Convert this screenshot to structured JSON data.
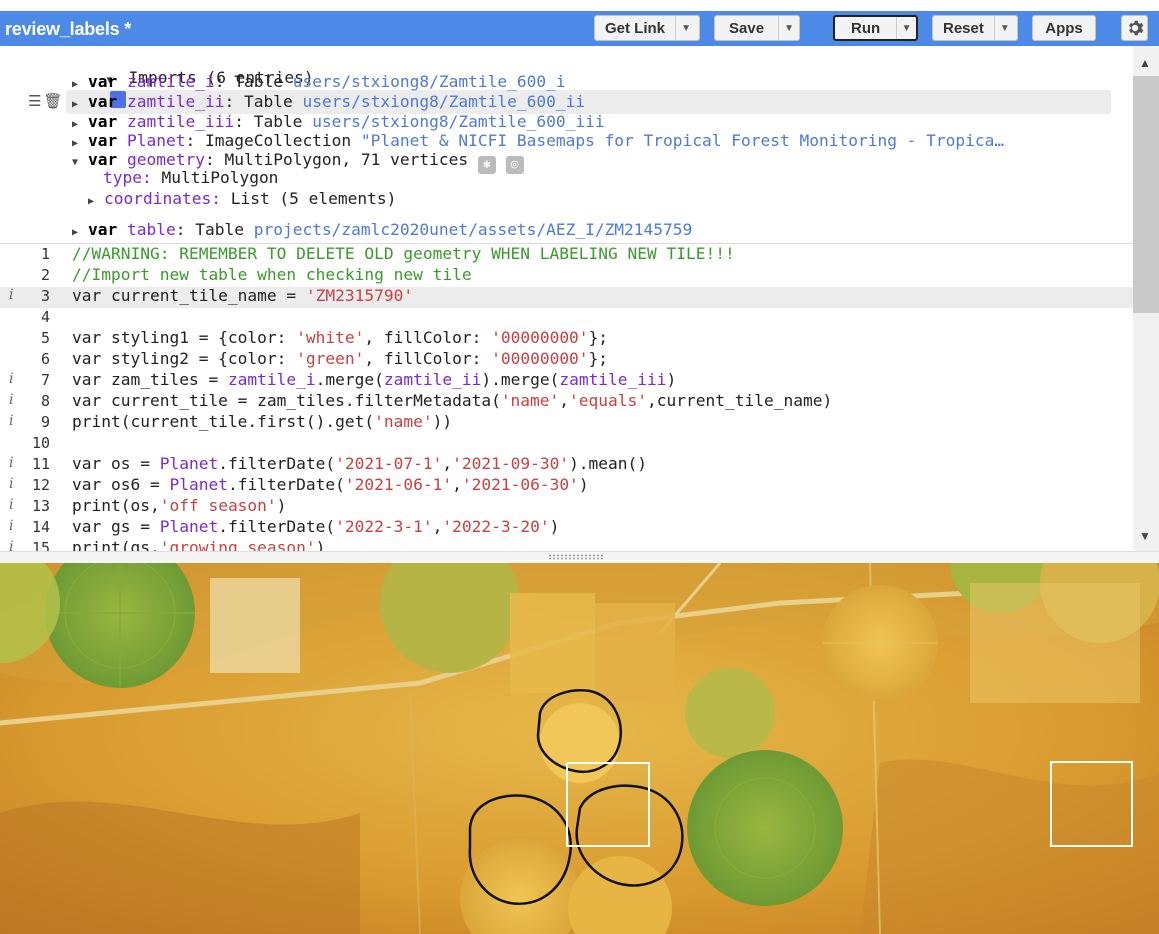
{
  "toolbar": {
    "title": "review_labels *",
    "get_link": "Get Link",
    "save": "Save",
    "run": "Run",
    "reset": "Reset",
    "apps": "Apps"
  },
  "imports": {
    "header": "Imports (6 entries)",
    "rows": [
      {
        "kw": "var",
        "name": "zamtile_i",
        "type": "Table",
        "value": "users/stxiong8/Zamtile_600_i"
      },
      {
        "kw": "var",
        "name": "zamtile_ii",
        "type": "Table",
        "value": "users/stxiong8/Zamtile_600_ii"
      },
      {
        "kw": "var",
        "name": "zamtile_iii",
        "type": "Table",
        "value": "users/stxiong8/Zamtile_600_iii"
      },
      {
        "kw": "var",
        "name": "Planet",
        "type": "ImageCollection",
        "value": "\"Planet & NICFI Basemaps for Tropical Forest Monitoring - Tropica…"
      },
      {
        "kw": "var",
        "name": "geometry",
        "type": "MultiPolygon, 71 vertices",
        "value": ""
      },
      {
        "kw": "var",
        "name": "table",
        "type": "Table",
        "value": "projects/zamlc2020unet/assets/AEZ_I/ZM2145759"
      }
    ],
    "geometry_type_key": "type:",
    "geometry_type_val": "MultiPolygon",
    "geometry_coords_key": "coordinates:",
    "geometry_coords_val": "List (5 elements)"
  },
  "code": {
    "line_numbers": [
      "1",
      "2",
      "3",
      "4",
      "5",
      "6",
      "7",
      "8",
      "9",
      "10",
      "11",
      "12",
      "13",
      "14",
      "15"
    ],
    "l1": "//WARNING: REMEMBER TO DELETE OLD geometry WHEN LABELING NEW TILE!!!",
    "l2": "//Import new table when checking new tile",
    "l3a": "var current_tile_name = ",
    "l3b": "'ZM2315790'",
    "l5a": "var styling1 = {color: ",
    "l5b": "'white'",
    "l5c": ", fillColor: ",
    "l5d": "'00000000'",
    "l5e": "};",
    "l6a": "var styling2 = {color: ",
    "l6b": "'green'",
    "l6c": ", fillColor: ",
    "l6d": "'00000000'",
    "l6e": "};",
    "l7a": "var zam_tiles = ",
    "l7b": "zamtile_i",
    "l7c": ".merge(",
    "l7d": "zamtile_ii",
    "l7e": ").merge(",
    "l7f": "zamtile_iii",
    "l7g": ")",
    "l8a": "var current_tile = zam_tiles.filterMetadata(",
    "l8b": "'name'",
    "l8c": ",",
    "l8d": "'equals'",
    "l8e": ",current_tile_name)",
    "l9a": "print(current_tile.first().get(",
    "l9b": "'name'",
    "l9c": "))",
    "l11a": "var os = ",
    "l11b": "Planet",
    "l11c": ".filterDate(",
    "l11d": "'2021-07-1'",
    "l11e": ",",
    "l11f": "'2021-09-30'",
    "l11g": ").mean()",
    "l12a": "var os6 = ",
    "l12b": "Planet",
    "l12c": ".filterDate(",
    "l12d": "'2021-06-1'",
    "l12e": ",",
    "l12f": "'2021-06-30'",
    "l12g": ")",
    "l13a": "print(os,",
    "l13b": "'off season'",
    "l13c": ")",
    "l14a": "var gs = ",
    "l14b": "Planet",
    "l14c": ".filterDate(",
    "l14d": "'2022-3-1'",
    "l14e": ",",
    "l14f": "'2022-3-20'",
    "l14g": ")",
    "l15a": "print(gs,",
    "l15b": "'growing season'",
    "l15c": ")"
  },
  "colors": {
    "toolbar": "#4d8ae8",
    "keyword": "#000000",
    "variable": "#7a2ad1",
    "string": "#c94040",
    "comment": "#3a9a2a",
    "path": "#4e79d9"
  }
}
